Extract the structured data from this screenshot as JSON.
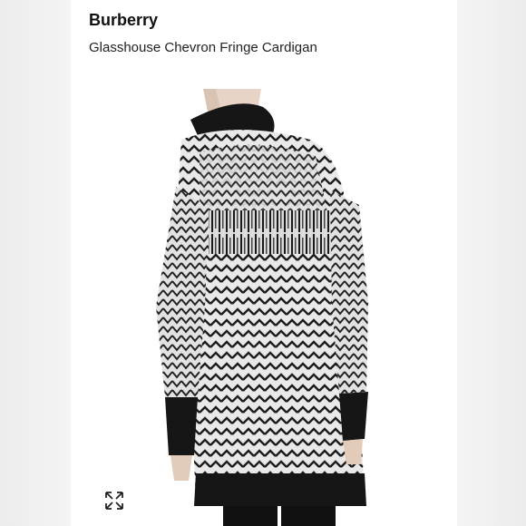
{
  "header": {
    "brand": "Burberry",
    "product_name": "Glasshouse Chevron Fringe Cardigan"
  },
  "product_image": {
    "subject": "black and white chevron knit cardigan with fringe, back view"
  },
  "controls": {
    "expand_icon": "expand-arrows-icon"
  },
  "colors": {
    "knit_light": "#e8e8e8",
    "knit_dark": "#1a1a1a",
    "background": "#ffffff"
  }
}
